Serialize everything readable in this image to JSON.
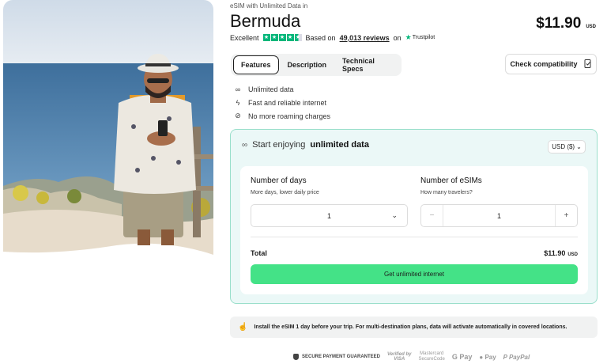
{
  "hero": {
    "alt_subject": "traveler-photo"
  },
  "header": {
    "eyebrow": "eSIM with Unlimited Data in",
    "title": "Bermuda",
    "price": "$11.90",
    "price_currency": "USD"
  },
  "rating": {
    "label": "Excellent",
    "stars": 4.5,
    "based_on": "Based on",
    "reviews": "49,013 reviews",
    "on": "on",
    "platform": "Trustpilot"
  },
  "tabs": [
    {
      "label": "Features",
      "active": true
    },
    {
      "label": "Description",
      "active": false
    },
    {
      "label": "Technical Specs",
      "active": false
    }
  ],
  "check_compat": {
    "label": "Check compatibility",
    "icon": "phone-check-icon"
  },
  "features": [
    {
      "icon": "infinity-icon",
      "label": "Unlimited data"
    },
    {
      "icon": "bolt-icon",
      "label": "Fast and reliable internet"
    },
    {
      "icon": "no-roaming-icon",
      "label": "No more roaming charges"
    }
  ],
  "card": {
    "heading_prefix": "Start enjoying",
    "heading_bold": "unlimited data",
    "currency_select": "USD ($)",
    "days": {
      "label": "Number of days",
      "sub": "More days, lower daily price",
      "value": "1"
    },
    "esims": {
      "label": "Number of eSIMs",
      "sub": "How many travelers?",
      "value": "1"
    },
    "total_label": "Total",
    "total_value": "$11.90",
    "total_currency": "USD",
    "cta": "Get unlimited internet"
  },
  "notice": "Install the eSIM 1 day before your trip. For multi-destination plans, data will activate automatically in covered locations.",
  "payments": {
    "secure": "SECURE PAYMENT GUARANTEED",
    "visa_top": "Verified by",
    "visa_bottom": "VISA",
    "mc_top": "Mastercard",
    "mc_bottom": "SecureCode",
    "gpay": "G Pay",
    "apay": "Pay",
    "paypal": "PayPal"
  },
  "colors": {
    "accent": "#44e287",
    "card_bg": "#ebf8f7",
    "card_border": "#9adfcb",
    "trustpilot": "#00b67a"
  }
}
